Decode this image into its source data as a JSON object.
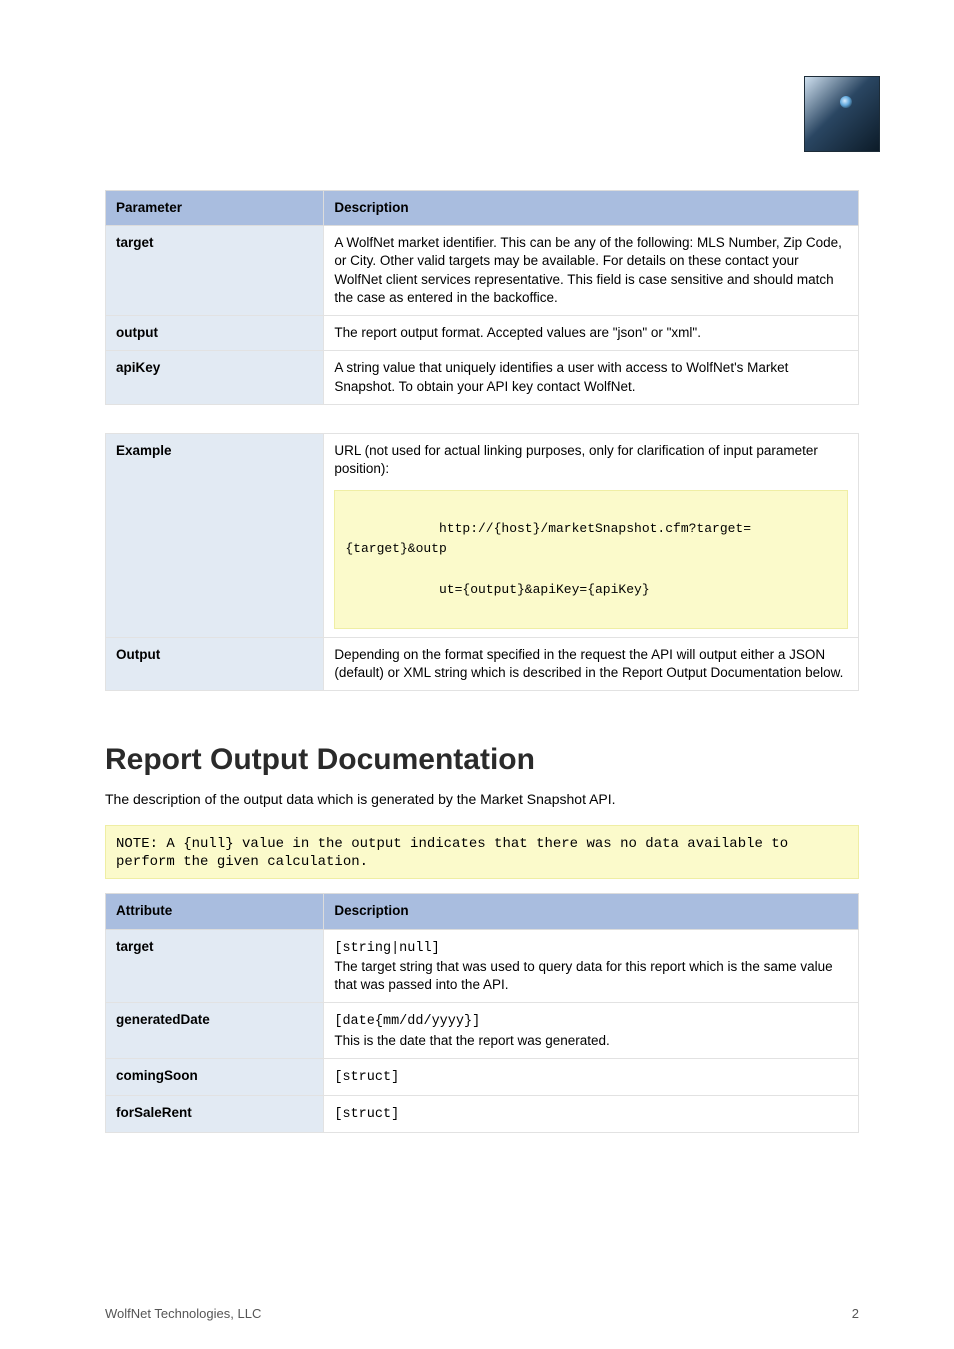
{
  "logo_alt": "Wolf eye logo",
  "tableA": {
    "headers": [
      "Parameter",
      "Description"
    ],
    "rows": [
      {
        "k": "target",
        "v": "A WolfNet market identifier. This can be any of the following: MLS Number, Zip Code, or City. Other valid targets may be available. For details on these contact your WolfNet client services representative. This field is case sensitive and should match the case as entered in the backoffice."
      },
      {
        "k": "output",
        "v": "The report output format. Accepted values are \"json\" or \"xml\"."
      },
      {
        "k": "apiKey",
        "v": "A string value that uniquely identifies a user with access to WolfNet's Market Snapshot. To obtain your API key contact WolfNet."
      }
    ]
  },
  "tableB": {
    "rows": [
      {
        "k": "Example",
        "plain": "URL (not used for actual linking purposes, only for clarification of input parameter position):",
        "code_lines": [
          "http://{host}/marketSnapshot.cfm?target={target}&outp",
          "ut={output}&apiKey={apiKey}"
        ]
      },
      {
        "k": "Output",
        "v": "Depending on the format specified in the request the API will output either a JSON (default) or XML string which is described in the Report Output Documentation below."
      }
    ]
  },
  "section2": {
    "title": "Report Output Documentation",
    "desc": "The description of the output data which is generated by the Market Snapshot API.",
    "note": "NOTE: A {null} value in the output indicates that there was no data available to perform the given calculation."
  },
  "tableC": {
    "headers": [
      "Attribute",
      "Description"
    ],
    "rows": [
      {
        "k": "target",
        "v_lines": [
          "[string|null]",
          "The target string that was used to query data for this report which is the same value that was passed into the API."
        ]
      },
      {
        "k": "generatedDate",
        "v_lines": [
          "[date{mm/dd/yyyy}]",
          "This is the date that the report was generated."
        ]
      },
      {
        "k": "comingSoon",
        "v_lines": [
          "[struct]"
        ]
      },
      {
        "k": "forSaleRent",
        "v_lines": [
          "[struct]"
        ]
      }
    ]
  },
  "footer": {
    "company": "WolfNet Technologies, LLC",
    "page": "2"
  }
}
